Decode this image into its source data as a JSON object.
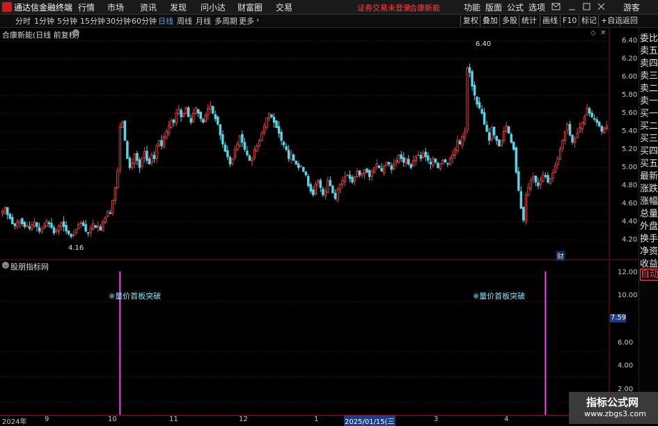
{
  "app": {
    "title": "通达信金融终端",
    "status": "证券交易未登录",
    "stock_title": "合康新能"
  },
  "menu": [
    "行情",
    "市场",
    "资讯",
    "发现",
    "问小达",
    "财富圈",
    "交易"
  ],
  "right_menu": [
    "功能",
    "版面",
    "公式",
    "选项"
  ],
  "user": "游客",
  "periods": [
    "分时",
    "1分钟",
    "5分钟",
    "15分钟",
    "30分钟",
    "60分钟",
    "日线",
    "周线",
    "月线",
    "多周期",
    "更多"
  ],
  "active_period": "日线",
  "toolbar": [
    "复权",
    "叠加",
    "多股",
    "统计",
    "画线",
    "F10",
    "标记",
    "+自选",
    "返回"
  ],
  "chart_title": "合康新能(日线 前复权)",
  "indicator_title": "股朋指标网",
  "side_panel": [
    "委比",
    "卖五",
    "卖四",
    "卖三",
    "卖二",
    "卖一",
    "买一",
    "买二",
    "买三",
    "买四",
    "买五",
    "最新",
    "涨跌",
    "涨幅",
    "总量",
    "外盘",
    "换手",
    "净资",
    "收益",
    "自动"
  ],
  "price_axis": [
    "6.40",
    "6.20",
    "6.00",
    "5.80",
    "5.60",
    "5.40",
    "5.20",
    "5.00",
    "4.80",
    "4.60",
    "4.40",
    "4.20"
  ],
  "indicator_axis": [
    "12.00",
    "10.00",
    "6.00",
    "4.00",
    "2.00"
  ],
  "indicator_current": "7.59",
  "annotations": {
    "high": "6.40",
    "low": "4.16",
    "fin": "财"
  },
  "signal_label": "※量价首板突破",
  "dates": [
    "2024年",
    "9",
    "10",
    "11",
    "12",
    "1",
    "2025/01/15(三",
    "3",
    "4"
  ],
  "watermark": {
    "line1": "指标公式网",
    "line2": "www.zbgs3.com"
  },
  "colors": {
    "up": "#e04040",
    "down": "#54d6e8",
    "signal": "#ff3cff",
    "background": "#000000"
  },
  "chart_data": {
    "type": "candlestick",
    "ylim": [
      4.1,
      6.45
    ],
    "indicator_ylim": [
      1.0,
      13.0
    ],
    "signals_at_bar": [
      48,
      222
    ],
    "closes": [
      4.52,
      4.56,
      4.48,
      4.44,
      4.38,
      4.36,
      4.4,
      4.42,
      4.38,
      4.35,
      4.36,
      4.33,
      4.37,
      4.4,
      4.35,
      4.3,
      4.32,
      4.36,
      4.41,
      4.38,
      4.34,
      4.28,
      4.31,
      4.36,
      4.39,
      4.35,
      4.3,
      4.27,
      4.24,
      4.26,
      4.32,
      4.37,
      4.39,
      4.36,
      4.3,
      4.28,
      4.33,
      4.38,
      4.34,
      4.36,
      4.31,
      4.4,
      4.45,
      4.52,
      4.5,
      4.64,
      4.78,
      4.96,
      5.45,
      5.5,
      5.3,
      5.1,
      5.0,
      5.05,
      5.15,
      5.08,
      5.0,
      5.1,
      5.18,
      5.08,
      5.04,
      5.14,
      5.1,
      5.24,
      5.3,
      5.24,
      5.34,
      5.4,
      5.46,
      5.52,
      5.5,
      5.6,
      5.64,
      5.56,
      5.6,
      5.66,
      5.56,
      5.5,
      5.6,
      5.66,
      5.6,
      5.54,
      5.5,
      5.58,
      5.65,
      5.68,
      5.6,
      5.54,
      5.48,
      5.36,
      5.26,
      5.18,
      5.12,
      5.04,
      5.1,
      5.2,
      5.26,
      5.35,
      5.28,
      5.2,
      5.14,
      5.08,
      5.1,
      5.2,
      5.24,
      5.3,
      5.38,
      5.46,
      5.55,
      5.6,
      5.56,
      5.5,
      5.44,
      5.38,
      5.3,
      5.25,
      5.2,
      5.1,
      5.16,
      5.08,
      5.04,
      5.0,
      5.02,
      4.96,
      4.92,
      4.8,
      4.74,
      4.7,
      4.82,
      4.86,
      4.78,
      4.7,
      4.74,
      4.86,
      4.8,
      4.72,
      4.66,
      4.76,
      4.82,
      4.86,
      4.9,
      4.92,
      4.88,
      4.84,
      4.9,
      4.96,
      4.92,
      4.94,
      4.98,
      4.95,
      4.9,
      4.96,
      5.0,
      5.04,
      5.0,
      4.96,
      5.02,
      5.06,
      5.04,
      4.98,
      5.04,
      5.08,
      5.14,
      5.1,
      5.06,
      5.1,
      5.04,
      5.0,
      5.08,
      5.12,
      5.14,
      5.1,
      5.16,
      5.12,
      5.08,
      5.04,
      5.1,
      5.06,
      5.0,
      5.04,
      5.08,
      5.06,
      5.04,
      5.1,
      5.14,
      5.2,
      5.3,
      5.26,
      5.34,
      5.4,
      6.1,
      6.05,
      5.9,
      5.8,
      5.7,
      5.66,
      5.6,
      5.48,
      5.4,
      5.3,
      5.44,
      5.36,
      5.3,
      5.24,
      5.3,
      5.4,
      5.46,
      5.38,
      5.28,
      5.2,
      4.95,
      4.75,
      4.55,
      4.42,
      4.7,
      4.78,
      4.86,
      4.9,
      4.84,
      4.8,
      4.86,
      4.92,
      4.9,
      4.84,
      4.88,
      4.94,
      5.02,
      5.1,
      5.2,
      5.3,
      5.4,
      5.48,
      5.36,
      5.28,
      5.32,
      5.38,
      5.44,
      5.5,
      5.56,
      5.66,
      5.6,
      5.56,
      5.54,
      5.5,
      5.46,
      5.4,
      5.44,
      5.46
    ]
  }
}
